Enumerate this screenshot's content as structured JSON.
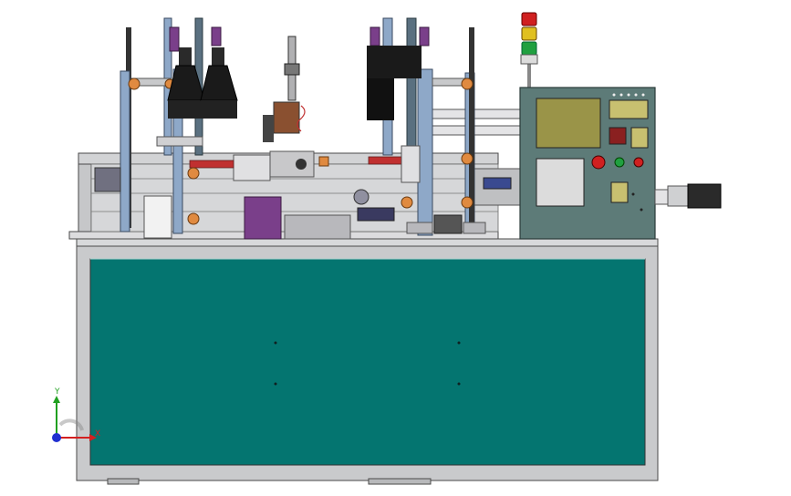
{
  "view": {
    "background": "#ffffff"
  },
  "triad": {
    "x_label": "X",
    "y_label": "Y",
    "x_color": "#d42020",
    "y_color": "#20a020",
    "z_color": "#2030d0"
  },
  "colors": {
    "frame_steel": "#c9cacc",
    "frame_edge": "#4a4a4a",
    "cabinet_panel": "#047570",
    "control_box": "#5d7b78",
    "control_screen": "#9a9448",
    "frame_blue": "#8ea8c8",
    "accent_purple": "#7a3f8a",
    "accent_orange": "#e08a40",
    "motor_black": "#1a1a1a",
    "red": "#d02020",
    "green": "#20a040",
    "yellow": "#e0c020"
  },
  "signal_tower": {
    "lamps": [
      "red",
      "yellow",
      "green"
    ]
  },
  "control_panel": {
    "buttons": [
      "red",
      "green",
      "red"
    ]
  }
}
